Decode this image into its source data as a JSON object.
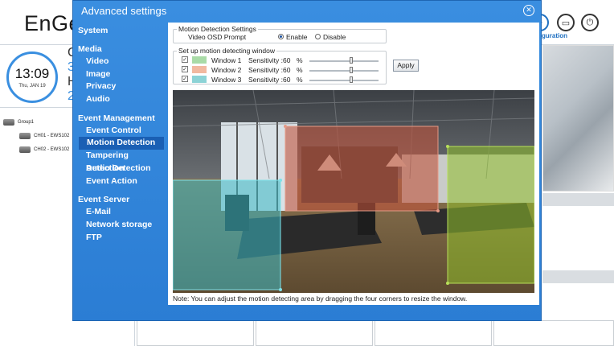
{
  "background": {
    "logo": "EnGe",
    "clock_time": "13:09",
    "clock_date": "Thu, JAN 19",
    "side_letters": [
      "C",
      "3",
      "H",
      "2"
    ],
    "header_link": "guration",
    "tree": {
      "group": "Group1",
      "channels": [
        "CH01 - EWS102",
        "CH02 - EWS102"
      ]
    }
  },
  "modal": {
    "title": "Advanced settings",
    "close_icon": "close-icon"
  },
  "nav": {
    "system": "System",
    "media": "Media",
    "media_items": [
      "Video",
      "Image",
      "Privacy",
      "Audio"
    ],
    "event_management": "Event Management",
    "event_items": [
      "Event Control",
      "Motion Detection",
      "Tampering Detection",
      "Audio Detection",
      "Event Action"
    ],
    "event_server": "Event Server",
    "server_items": [
      "E-Mail",
      "Network storage",
      "FTP"
    ],
    "active": "Motion Detection"
  },
  "motion": {
    "settings_legend": "Motion Detection Settings",
    "osd_label": "Video OSD Prompt",
    "enable_label": "Enable",
    "disable_label": "Disable",
    "osd_value": "Enable",
    "window_legend": "Set up motion detecting window",
    "sensitivity_label": "Sensitivity :",
    "percent": "%",
    "apply_label": "Apply",
    "windows": [
      {
        "name": "Window 1",
        "checked": true,
        "sensitivity": "60",
        "color": "#a9dba7"
      },
      {
        "name": "Window 2",
        "checked": true,
        "sensitivity": "60",
        "color": "#f2b9a0"
      },
      {
        "name": "Window 3",
        "checked": true,
        "sensitivity": "60",
        "color": "#8dd3d6"
      }
    ],
    "note": "Note: You can adjust the motion detecting area by dragging the four corners to resize the window."
  },
  "colors": {
    "modal_blue": "#2f84d8",
    "active_nav": "#1a5fb4",
    "window1_overlay": "#8fbf2a",
    "window2_overlay": "#c0533c",
    "window3_overlay": "#3bb9c4"
  }
}
